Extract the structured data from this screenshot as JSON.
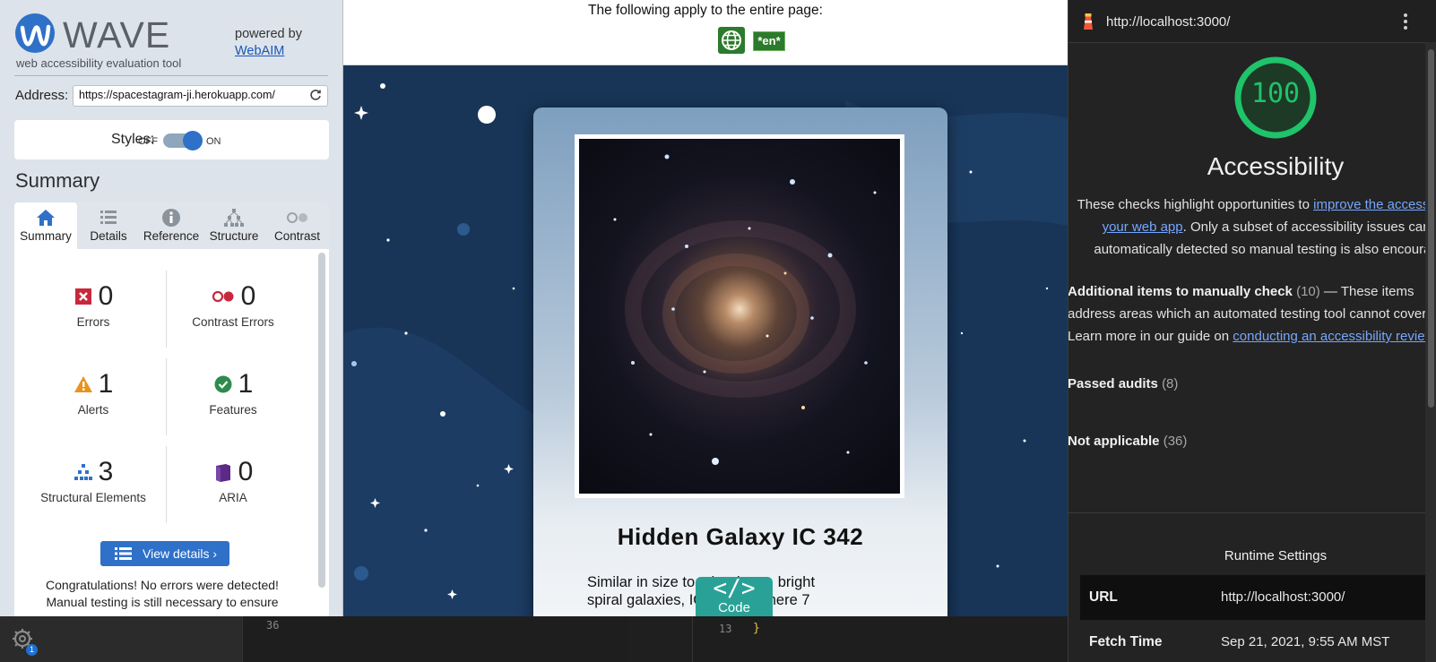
{
  "wave": {
    "title": "WAVE",
    "subtitle": "web accessibility evaluation tool",
    "powered_by": "powered by",
    "webaim_link": "WebAIM",
    "address_label": "Address:",
    "address_value": "https://spacestagram-ji.herokuapp.com/",
    "styles_label": "Styles:",
    "styles_off": "OFF",
    "styles_on": "ON",
    "summary_heading": "Summary",
    "tabs": [
      {
        "label": "Summary",
        "icon": "home-icon"
      },
      {
        "label": "Details",
        "icon": "list-icon"
      },
      {
        "label": "Reference",
        "icon": "info-icon"
      },
      {
        "label": "Structure",
        "icon": "hierarchy-icon"
      },
      {
        "label": "Contrast",
        "icon": "contrast-icon"
      }
    ],
    "stats": {
      "errors": {
        "value": "0",
        "label": "Errors"
      },
      "contrast_errors": {
        "value": "0",
        "label": "Contrast Errors"
      },
      "alerts": {
        "value": "1",
        "label": "Alerts"
      },
      "features": {
        "value": "1",
        "label": "Features"
      },
      "structural": {
        "value": "3",
        "label": "Structural Elements"
      },
      "aria": {
        "value": "0",
        "label": "ARIA"
      }
    },
    "view_details": "View details ›",
    "congrats_line1": "Congratulations! No errors were detected!",
    "congrats_line2": "Manual testing is still necessary to ensure"
  },
  "page": {
    "apply_text": "The following apply to the entire page:",
    "lang_tag": "*en*",
    "card_title": "Hidden Galaxy IC 342",
    "card_desc_line1": "Similar in size to other large, bright",
    "card_desc_line2": "spiral galaxies, IC 342 is a mere 7",
    "code_button": "Code",
    "code_icon": "</>"
  },
  "editor": {
    "line_36": "36",
    "line_13": "13",
    "brace": "}",
    "notification_count": "1"
  },
  "lighthouse": {
    "url": "http://localhost:3000/",
    "score": "100",
    "category": "Accessibility",
    "desc_pre": "These checks highlight opportunities to ",
    "desc_link": "improve the accessibility of",
    "desc_link2": "your web app",
    "desc_mid": ". Only a subset of accessibility issues can be",
    "desc_line3": "automatically detected so manual testing is also encouraged.",
    "manual_title": "Additional items to manually check",
    "manual_count": "(10)",
    "manual_text1": " — These items",
    "manual_text2": "address areas which an automated testing tool cannot cover.",
    "manual_text3": "Learn more in our guide on ",
    "manual_link": "conducting an accessibility review",
    "passed_label": "Passed audits",
    "passed_count": "(8)",
    "na_label": "Not applicable",
    "na_count": "(36)",
    "runtime_title": "Runtime Settings",
    "runtime_rows": [
      {
        "key": "URL",
        "value": "http://localhost:3000/"
      },
      {
        "key": "Fetch Time",
        "value": "Sep 21, 2021, 9:55 AM MST"
      }
    ],
    "accent_green": "#1fc36a"
  }
}
